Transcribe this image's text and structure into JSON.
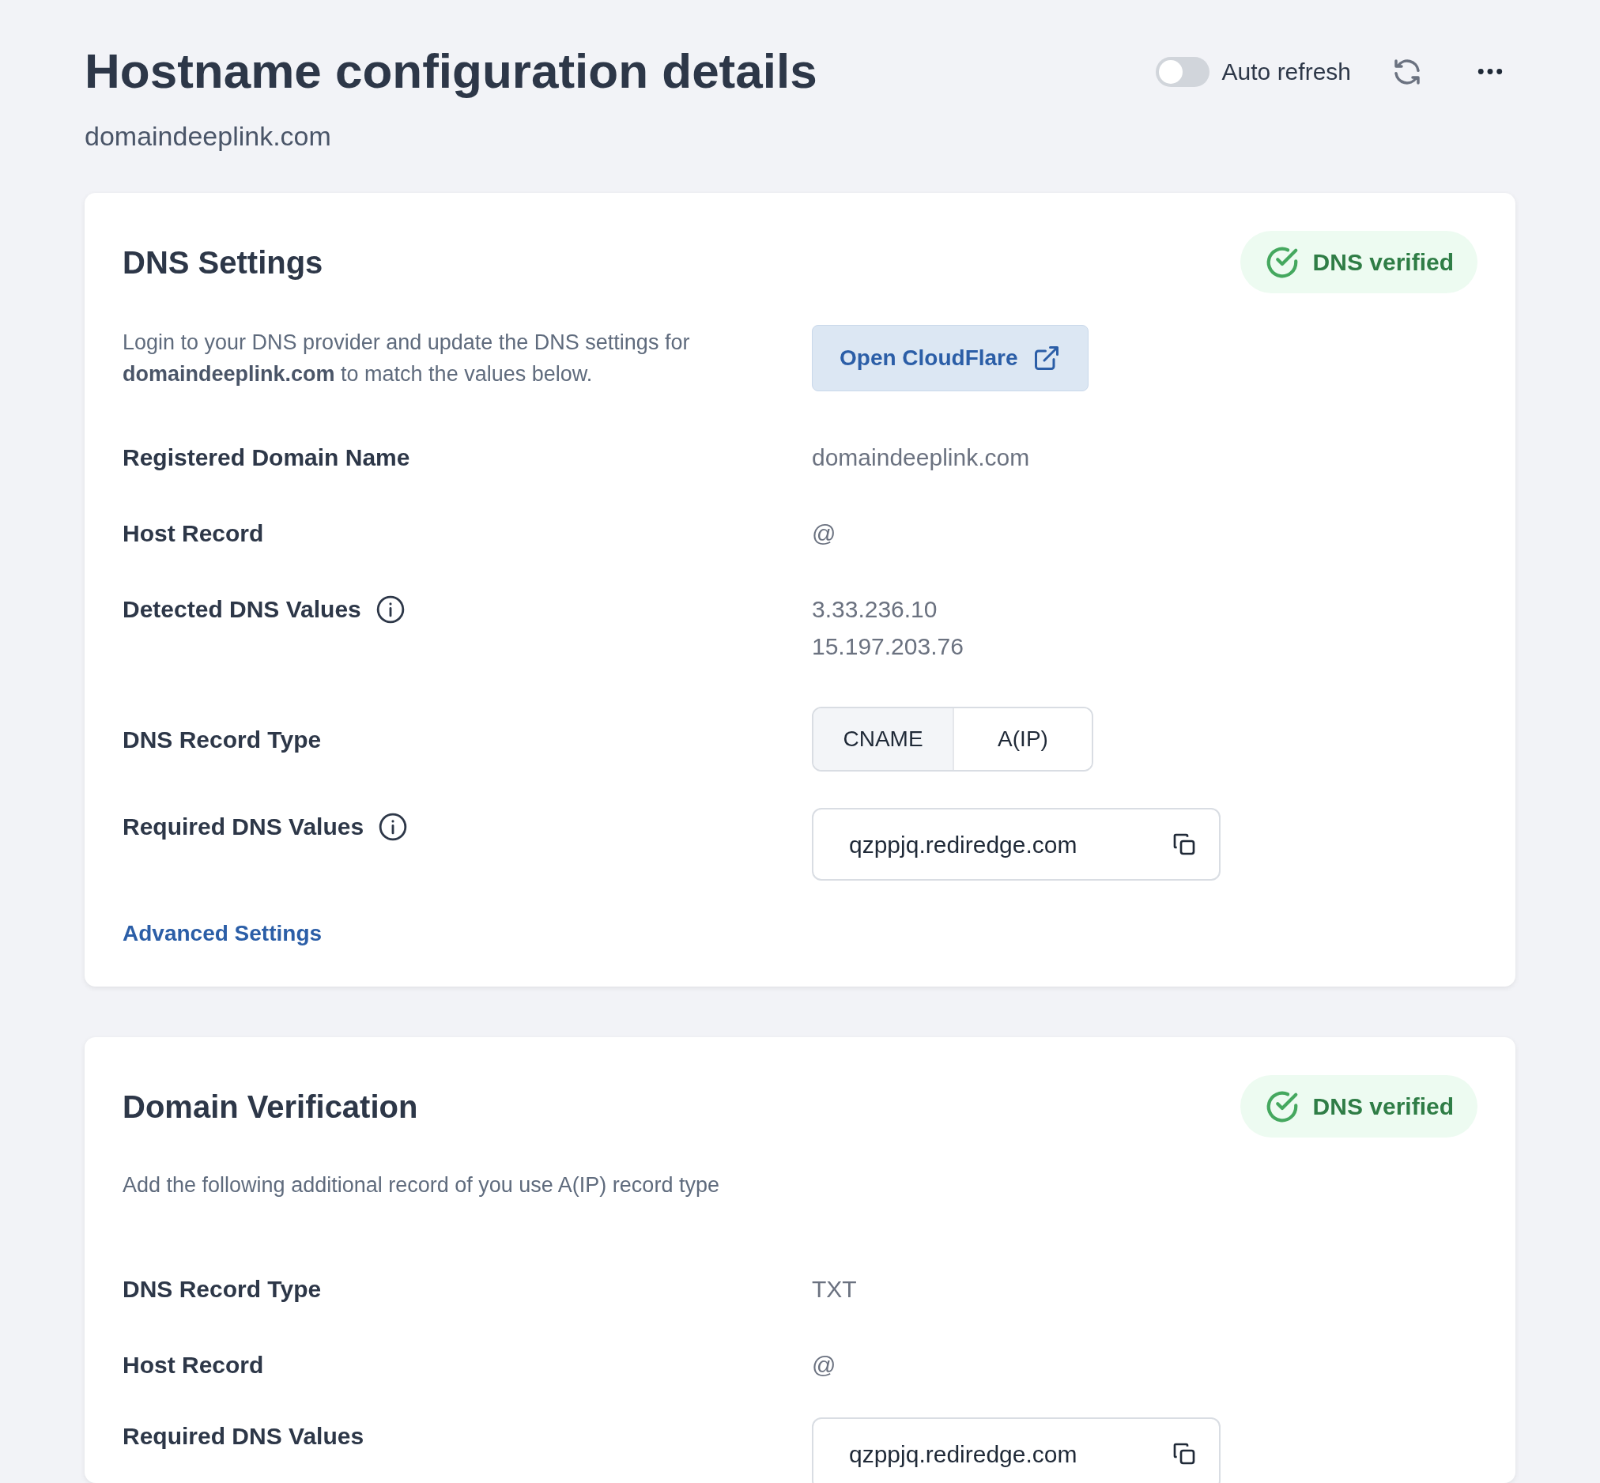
{
  "header": {
    "title": "Hostname configuration details",
    "subtitle": "domaindeeplink.com",
    "auto_refresh": {
      "label": "Auto refresh",
      "on": false
    }
  },
  "sections": [
    {
      "title": "DNS Settings",
      "badge": "DNS verified",
      "description": "Login to your DNS provider and update the DNS settings for **domaindeeplink.com** to match the values below.",
      "action_button": "Open CloudFlare",
      "rows": [
        {
          "kind": "text",
          "label": "Registered Domain Name",
          "value": "domaindeeplink.com"
        },
        {
          "kind": "text",
          "label": "Host Record",
          "value": "@"
        },
        {
          "kind": "list",
          "label": "Detected DNS Values",
          "info": true,
          "values": [
            "3.33.236.10",
            "15.197.203.76"
          ]
        },
        {
          "kind": "segmented",
          "label": "DNS Record Type",
          "options": [
            {
              "label": "CNAME",
              "selected": true
            },
            {
              "label": "A(IP)",
              "selected": false
            }
          ]
        },
        {
          "kind": "copy",
          "label": "Required DNS Values",
          "info": true,
          "value": "qzppjq.rediredge.com"
        }
      ],
      "link": "Advanced Settings"
    },
    {
      "title": "Domain Verification",
      "badge": "DNS verified",
      "description": "Add the following additional record of you use A(IP) record type",
      "rows": [
        {
          "kind": "text",
          "label": "DNS Record Type",
          "value": "TXT"
        },
        {
          "kind": "text",
          "label": "Host Record",
          "value": "@"
        },
        {
          "kind": "copy",
          "label": "Required DNS Values",
          "value": "qzppjq.rediredge.com"
        }
      ]
    }
  ]
}
